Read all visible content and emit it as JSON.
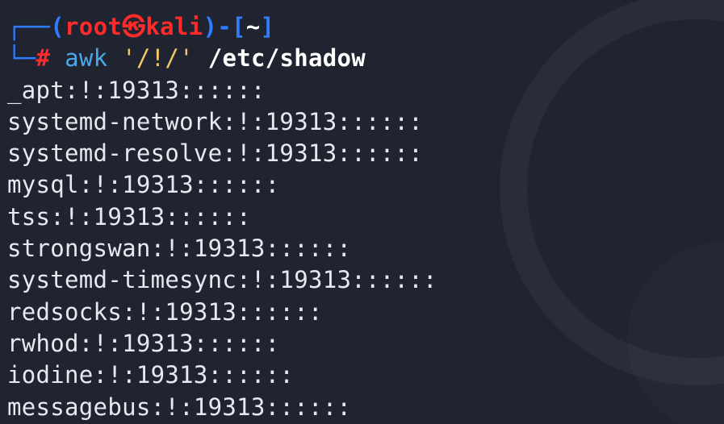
{
  "prompt": {
    "corner_top": "┌──",
    "open_paren": "(",
    "user": "root",
    "at_symbol": "㉿",
    "host": "kali",
    "close_paren": ")",
    "dash": "-",
    "open_bracket": "[",
    "cwd": "~",
    "close_bracket": "]",
    "corner_bottom": "└─",
    "hash": "#",
    "command": "awk",
    "argument": "'/!/'",
    "path": "/etc/shadow"
  },
  "output_lines": [
    "_apt:!:19313::::::",
    "systemd-network:!:19313::::::",
    "systemd-resolve:!:19313::::::",
    "mysql:!:19313::::::",
    "tss:!:19313::::::",
    "strongswan:!:19313::::::",
    "systemd-timesync:!:19313::::::",
    "redsocks:!:19313::::::",
    "rwhod:!:19313::::::",
    "iodine:!:19313::::::",
    "messagebus:!:19313::::::"
  ],
  "colors": {
    "background": "#1f2430",
    "prompt_blue": "#2f7dff",
    "prompt_red": "#ff2a2a",
    "command_blue": "#4aa8e8",
    "argument_yellow": "#f3c76a",
    "text": "#e6e9ef"
  }
}
